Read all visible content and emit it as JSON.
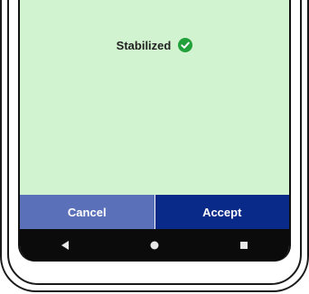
{
  "status": {
    "text": "Stabilized",
    "icon": "check-circle-icon",
    "icon_color": "#22a03a"
  },
  "buttons": {
    "cancel_label": "Cancel",
    "accept_label": "Accept"
  },
  "nav_bar": {
    "back_icon": "back-triangle-icon",
    "home_icon": "home-circle-icon",
    "recents_icon": "recents-square-icon"
  },
  "colors": {
    "screen_bg": "#d1f3cf",
    "cancel_bg": "#5a70b8",
    "accept_bg": "#0a2a8a",
    "nav_bg": "#0b0b0b"
  }
}
